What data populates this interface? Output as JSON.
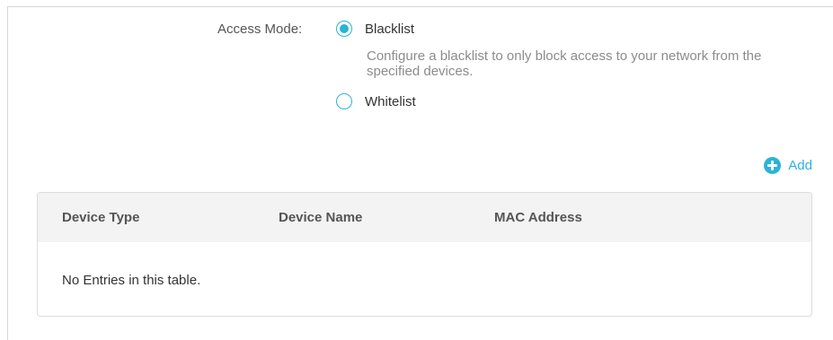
{
  "access_mode": {
    "label": "Access Mode:",
    "options": [
      {
        "label": "Blacklist",
        "selected": true
      },
      {
        "label": "Whitelist",
        "selected": false
      }
    ],
    "blacklist_hint": "Configure a blacklist to only block access to your network from the specified devices."
  },
  "add_button": {
    "label": "Add",
    "icon": "plus-circle-icon"
  },
  "table": {
    "columns": [
      "Device Type",
      "Device Name",
      "MAC Address"
    ],
    "empty_message": "No Entries in this table."
  },
  "colors": {
    "accent": "#2bb3d7",
    "header_bg": "#f3f3f3",
    "hint_text": "#8c8c8c"
  }
}
